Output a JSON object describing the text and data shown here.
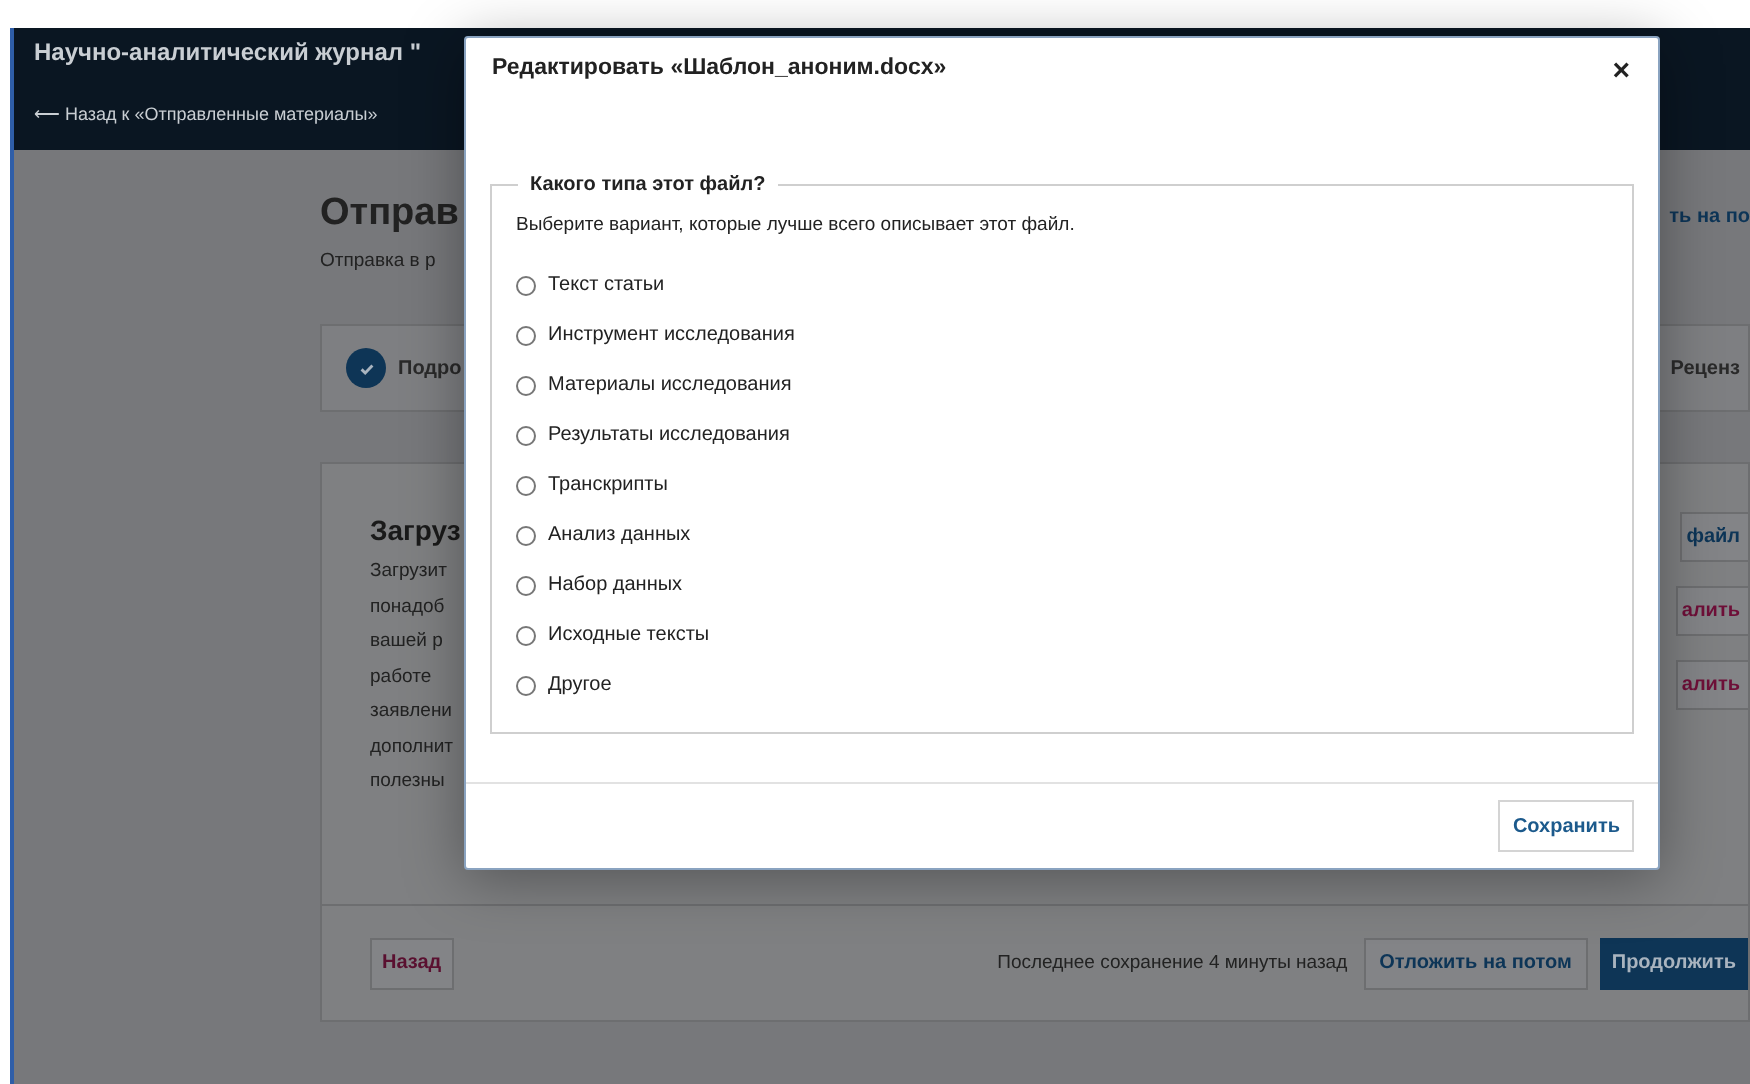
{
  "header": {
    "title": "Научно-аналитический журнал \"",
    "back_link": "⟵ Назад к «Отправленные материалы»"
  },
  "page": {
    "heading": "Отправ",
    "subtitle": "Отправка в р",
    "save_later_link": "ть на по",
    "steps": [
      {
        "label": "Подро",
        "completed": true
      },
      {
        "label": "Реценз",
        "completed": false
      }
    ],
    "upload": {
      "title": "Загруз",
      "description_lines": [
        "Загрузит",
        "понадоб",
        "вашей р",
        "работе",
        "заявлени",
        "дополнит",
        "полезны"
      ],
      "buttons": [
        {
          "label": "файл",
          "kind": "primary"
        },
        {
          "label": "алить",
          "kind": "danger"
        },
        {
          "label": "алить",
          "kind": "danger"
        }
      ]
    },
    "footer": {
      "back_button": "Назад",
      "last_saved": "Последнее сохранение 4 минуты назад",
      "save_later_button": "Отложить на потом",
      "continue_button": "Продолжить"
    }
  },
  "modal": {
    "title": "Редактировать «Шаблон_аноним.docx»",
    "close": "×",
    "legend": "Какого типа этот файл?",
    "description": "Выберите вариант, которые лучше всего описывает этот файл.",
    "options": [
      {
        "label": "Текст статьи",
        "selected": false
      },
      {
        "label": "Инструмент исследования",
        "selected": false
      },
      {
        "label": "Материалы исследования",
        "selected": false
      },
      {
        "label": "Результаты исследования",
        "selected": false
      },
      {
        "label": "Транскрипты",
        "selected": false
      },
      {
        "label": "Анализ данных",
        "selected": false
      },
      {
        "label": "Набор данных",
        "selected": false
      },
      {
        "label": "Исходные тексты",
        "selected": false
      },
      {
        "label": "Другое",
        "selected": false
      }
    ],
    "save_button": "Сохранить"
  }
}
